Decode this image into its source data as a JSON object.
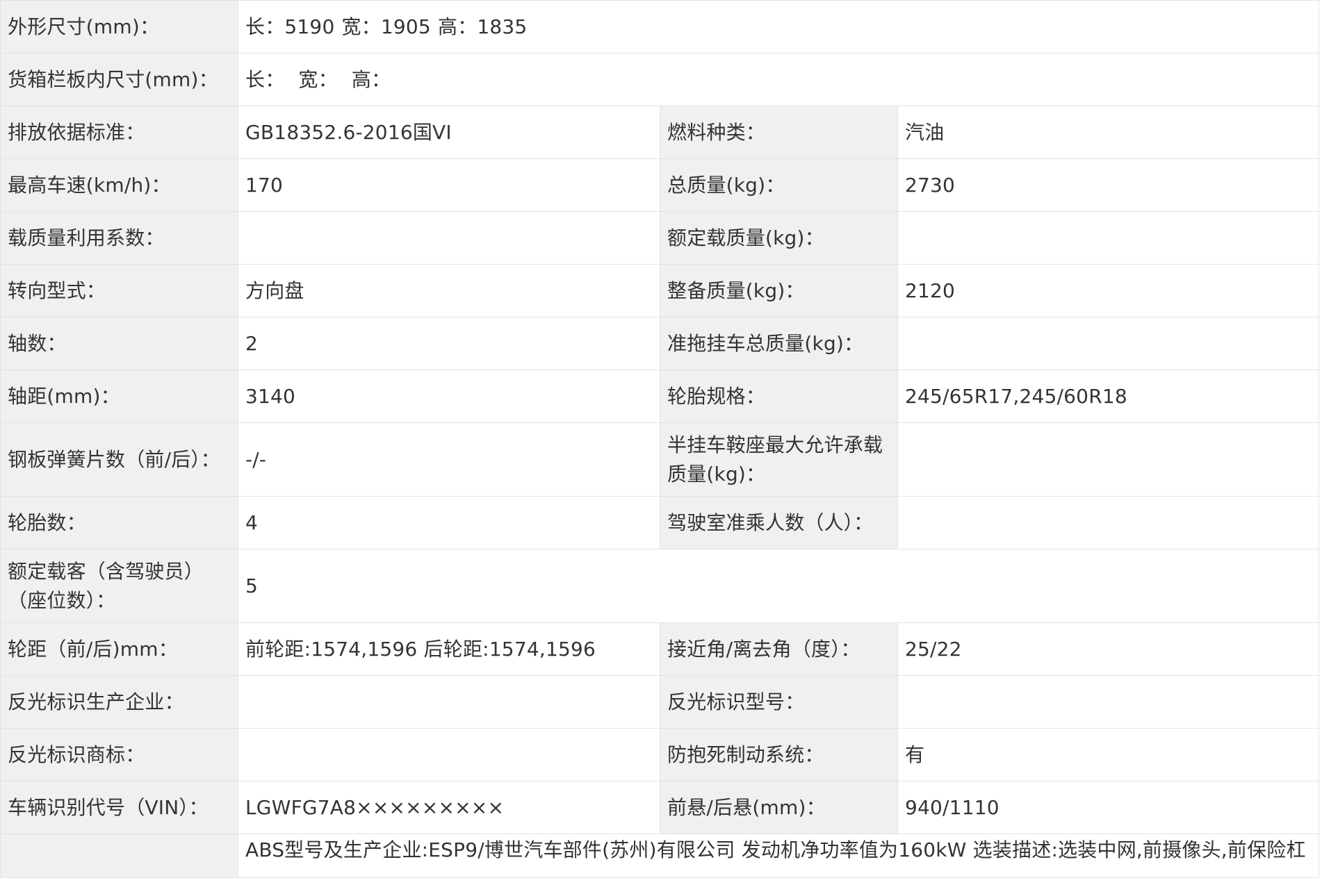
{
  "rows": {
    "dimensions": {
      "label": "外形尺寸(mm)：",
      "length_label": "长：",
      "length": "5190",
      "width_label": "宽：",
      "width": "1905",
      "height_label": "高：",
      "height": "1835"
    },
    "cargo_box": {
      "label": "货箱栏板内尺寸(mm)：",
      "length_label": "长：",
      "width_label": "宽：",
      "height_label": "高："
    },
    "emission": {
      "label": "排放依据标准：",
      "value": "GB18352.6-2016国VI"
    },
    "fuel": {
      "label": "燃料种类：",
      "value": "汽油"
    },
    "max_speed": {
      "label": "最高车速(km/h)：",
      "value": "170"
    },
    "gross_mass": {
      "label": "总质量(kg)：",
      "value": "2730"
    },
    "load_factor": {
      "label": "载质量利用系数：",
      "value": ""
    },
    "rated_load": {
      "label": "额定载质量(kg)：",
      "value": ""
    },
    "steering": {
      "label": "转向型式：",
      "value": "方向盘"
    },
    "curb_mass": {
      "label": "整备质量(kg)：",
      "value": "2120"
    },
    "axles": {
      "label": "轴数：",
      "value": "2"
    },
    "trailer_mass": {
      "label": "准拖挂车总质量(kg)：",
      "value": ""
    },
    "wheelbase": {
      "label": "轴距(mm)：",
      "value": "3140"
    },
    "tire_spec": {
      "label": "轮胎规格：",
      "value": "245/65R17,245/60R18"
    },
    "leaf_springs": {
      "label": "钢板弹簧片数（前/后）：",
      "value": "-/-"
    },
    "saddle_load": {
      "label": "半挂车鞍座最大允许承载质量(kg)：",
      "value": ""
    },
    "tires": {
      "label": "轮胎数：",
      "value": "4"
    },
    "cab_passengers": {
      "label": "驾驶室准乘人数（人）：",
      "value": ""
    },
    "seats": {
      "label": "额定载客（含驾驶员）（座位数）：",
      "value": "5"
    },
    "track": {
      "label": "轮距（前/后)mm：",
      "value": "前轮距:1574,1596 后轮距:1574,1596"
    },
    "angles": {
      "label": "接近角/离去角（度）：",
      "value": "25/22"
    },
    "reflector_maker": {
      "label": "反光标识生产企业：",
      "value": ""
    },
    "reflector_model": {
      "label": "反光标识型号：",
      "value": ""
    },
    "reflector_brand": {
      "label": "反光标识商标：",
      "value": ""
    },
    "abs": {
      "label": "防抱死制动系统：",
      "value": "有"
    },
    "vin": {
      "label": "车辆识别代号（VIN）：",
      "value": "LGWFG7A8×××××××××"
    },
    "overhang": {
      "label": "前悬/后悬(mm)：",
      "value": "940/1110"
    },
    "remarks": {
      "label": "",
      "value": "ABS型号及生产企业:ESP9/博世汽车部件(苏州)有限公司 发动机净功率值为160kW 选装描述:选装中网,前摄像头,前保险杠"
    }
  }
}
